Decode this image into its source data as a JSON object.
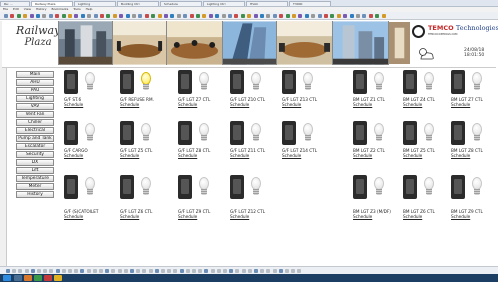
{
  "browser": {
    "tabs": [
      "Re: ...",
      "Railway Plaza",
      "Lighting",
      "Building Ctrl",
      "Schedule",
      "Lighting Ctrl",
      "HVAC",
      "T3000"
    ],
    "menu": [
      "File",
      "Edit",
      "View",
      "History",
      "Bookmarks",
      "Tools",
      "Help"
    ]
  },
  "header": {
    "logo_line1": "Railway",
    "logo_line2": "Plaza",
    "brand_name": "TEMCO",
    "brand_suffix": "Technologies",
    "brand_sub": "TEMCOCONTROLS.COM",
    "date": "24/08/18",
    "time": "18:01:50"
  },
  "sidebar": {
    "items": [
      "Main",
      "AHU",
      "PAU",
      "Lighting",
      "VAV",
      "Vent Fan",
      "Chiller",
      "Electrical",
      "Pump and Tank",
      "Escalator",
      "Security",
      "DX",
      "Lift",
      "Temperature",
      "Meter",
      "History"
    ]
  },
  "cards": [
    {
      "label": "G/F ST.6",
      "schedule": "Schedule",
      "on": false
    },
    {
      "label": "G/F REFUSE RM.",
      "schedule": "Schedule",
      "on": true
    },
    {
      "label": "G/F LGT Z7 CTL",
      "schedule": "Schedule",
      "on": false
    },
    {
      "label": "G/F LGT Z10 CTL",
      "schedule": "Schedule",
      "on": false
    },
    {
      "label": "G/F LGT Z13 CTL",
      "schedule": "Schedule",
      "on": false
    },
    {
      "label": "BM LGT Z1 CTL",
      "schedule": "Schedule",
      "on": false
    },
    {
      "label": "BM LGT Z4 CTL",
      "schedule": "Schedule",
      "on": false
    },
    {
      "label": "BM LGT Z7 CTL",
      "schedule": "Schedule",
      "on": false
    },
    {
      "label": "G/F CARGO",
      "schedule": "Schedule",
      "on": false
    },
    {
      "label": "G/F LGT Z5 CTL",
      "schedule": "Schedule",
      "on": false
    },
    {
      "label": "G/F LGT Z8 CTL",
      "schedule": "Schedule",
      "on": false
    },
    {
      "label": "G/F LGT Z11 CTL",
      "schedule": "Schedule",
      "on": false
    },
    {
      "label": "G/F LGT Z14 CTL",
      "schedule": "Schedule",
      "on": false
    },
    {
      "label": "BM LGT Z2 CTL",
      "schedule": "Schedule",
      "on": false
    },
    {
      "label": "BM LGT Z5 CTL",
      "schedule": "Schedule",
      "on": false
    },
    {
      "label": "BM LGT Z8 CTL",
      "schedule": "Schedule",
      "on": false
    },
    {
      "label": "G/F (S)CATOILET",
      "schedule": "Schedule",
      "on": false
    },
    {
      "label": "G/F LGT Z6 CTL",
      "schedule": "Schedule",
      "on": false
    },
    {
      "label": "G/F LGT Z9 CTL",
      "schedule": "Schedule",
      "on": false
    },
    {
      "label": "G/F LGT Z12 CTL",
      "schedule": "Schedule",
      "on": false
    },
    {
      "label": "BM LGT Z3 (M/DF)",
      "schedule": "Schedule",
      "on": false
    },
    {
      "label": "BM LGT Z6 CTL",
      "schedule": "Schedule",
      "on": false
    },
    {
      "label": "BM LGT Z9 CTL",
      "schedule": "Schedule",
      "on": false
    }
  ],
  "colors": {
    "bulb_on": "#ffe94a",
    "bulb_off": "#dedede",
    "taskbar": "#1d3e63",
    "brand_red": "#c62828",
    "brand_blue": "#1e3f8a"
  }
}
